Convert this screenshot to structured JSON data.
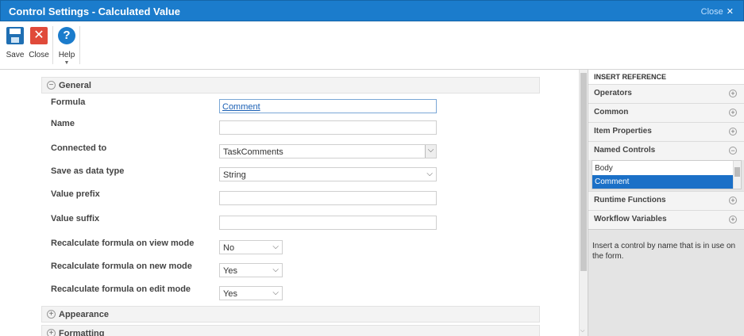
{
  "window": {
    "title": "Control Settings - Calculated Value",
    "close_label": "Close",
    "close_glyph": "✕"
  },
  "ribbon": {
    "save_label": "Save",
    "close_label": "Close",
    "help_label": "Help",
    "close_icon_glyph": "✕",
    "help_icon_glyph": "?",
    "help_caret": "▼"
  },
  "general": {
    "title": "General",
    "sign": "−",
    "fields": {
      "formula": {
        "label": "Formula",
        "value": "Comment"
      },
      "name": {
        "label": "Name",
        "value": ""
      },
      "connected_to": {
        "label": "Connected to",
        "value": "TaskComments"
      },
      "data_type": {
        "label": "Save as data type",
        "value": "String"
      },
      "value_prefix": {
        "label": "Value prefix",
        "value": ""
      },
      "value_suffix": {
        "label": "Value suffix",
        "value": ""
      },
      "recalc_view": {
        "label": "Recalculate formula on view mode",
        "value": "No"
      },
      "recalc_new": {
        "label": "Recalculate formula on new mode",
        "value": "Yes"
      },
      "recalc_edit": {
        "label": "Recalculate formula on edit mode",
        "value": "Yes"
      }
    }
  },
  "appearance": {
    "title": "Appearance",
    "sign": "+"
  },
  "formatting": {
    "title": "Formatting",
    "sign": "+"
  },
  "insert_reference": {
    "heading": "INSERT REFERENCE",
    "items": {
      "operators": "Operators",
      "common": "Common",
      "item_properties": "Item Properties",
      "named_controls": "Named Controls",
      "runtime_functions": "Runtime Functions",
      "workflow_variables": "Workflow Variables"
    },
    "named_controls_list": [
      "Body",
      "Comment"
    ],
    "selected": "Comment",
    "description": "Insert a control by name that is in use on the form."
  },
  "glyphs": {
    "chevron": "⌵",
    "plus": "+",
    "minus": "−"
  },
  "colors": {
    "title_bar": "#1b7ccc",
    "selection": "#1b70c7",
    "close_red": "#e04a3a"
  }
}
